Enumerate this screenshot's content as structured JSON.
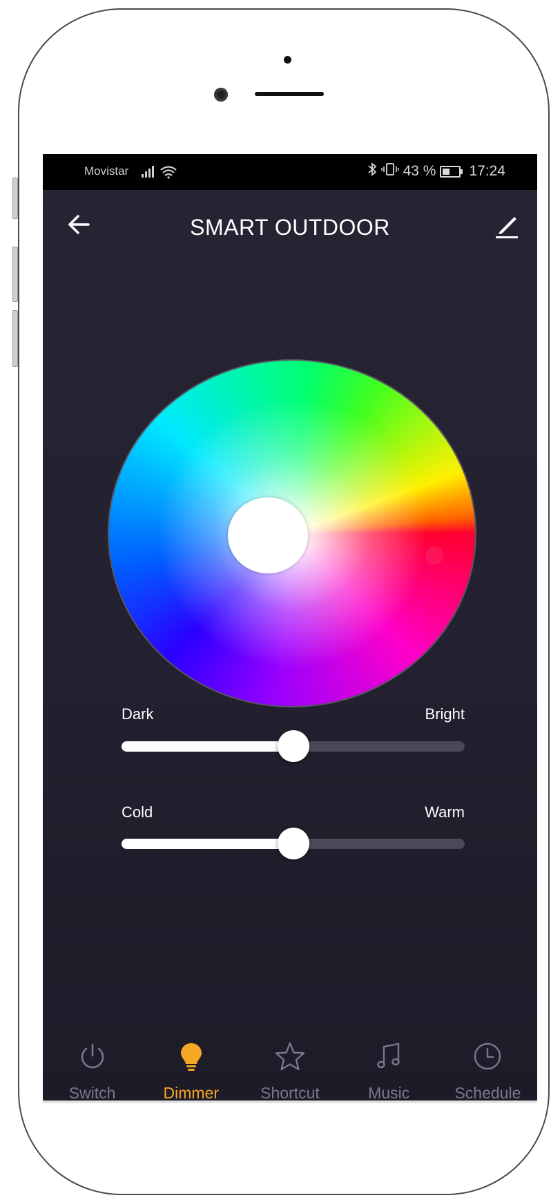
{
  "status_bar": {
    "carrier": "Movistar",
    "battery_percent": "43 %",
    "time": "17:24"
  },
  "header": {
    "title": "SMART OUTDOOR"
  },
  "sliders": [
    {
      "left_label": "Dark",
      "right_label": "Bright",
      "value": 0.5
    },
    {
      "left_label": "Cold",
      "right_label": "Warm",
      "value": 0.5
    }
  ],
  "tabs": [
    {
      "label": "Switch",
      "icon": "power-icon"
    },
    {
      "label": "Dimmer",
      "icon": "bulb-icon",
      "active": true
    },
    {
      "label": "Shortcut",
      "icon": "star-icon"
    },
    {
      "label": "Music",
      "icon": "music-note-icon"
    },
    {
      "label": "Schedule",
      "icon": "clock-icon"
    }
  ],
  "colors": {
    "accent": "#f5a623",
    "background": "#23212f",
    "inactive": "#7a7889"
  }
}
